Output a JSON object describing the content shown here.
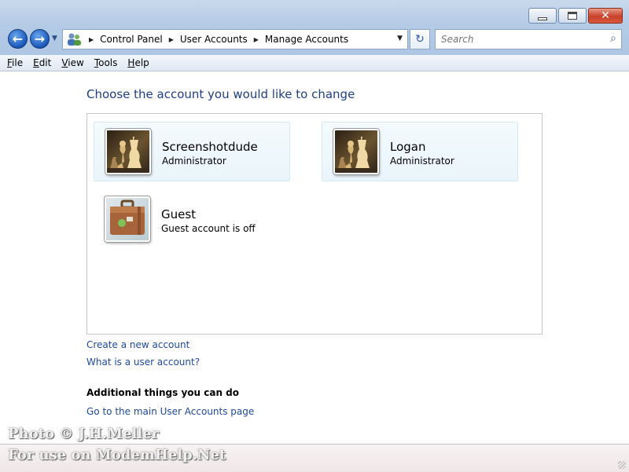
{
  "window": {
    "minimize_glyph": "",
    "maximize_glyph": "",
    "close_glyph": "✕"
  },
  "nav": {
    "back_glyph": "←",
    "forward_glyph": "→",
    "recent_glyph": "▼"
  },
  "address": {
    "separator_glyph": "▶",
    "crumbs": [
      "Control Panel",
      "User Accounts",
      "Manage Accounts"
    ],
    "dropdown_glyph": "▼",
    "refresh_glyph": "↻"
  },
  "search": {
    "placeholder": "Search",
    "icon_glyph": "⌕"
  },
  "menu": {
    "items": [
      "File",
      "Edit",
      "View",
      "Tools",
      "Help"
    ]
  },
  "main": {
    "heading": "Choose the account you would like to change",
    "accounts": [
      {
        "name": "Screenshotdude",
        "role": "Administrator",
        "picture": "chess-icon"
      },
      {
        "name": "Logan",
        "role": "Administrator",
        "picture": "chess-icon"
      },
      {
        "name": "Guest",
        "role": "Guest account is off",
        "picture": "suitcase-icon"
      }
    ],
    "links": {
      "create_account": "Create a new account",
      "what_is": "What is a user account?"
    },
    "additional_heading": "Additional things you can do",
    "main_page_link": "Go to the main User Accounts page"
  },
  "watermark": {
    "line1": "Photo © J.H.Meller",
    "line2": "For use on ModemHelp.Net"
  },
  "colors": {
    "heading": "#1e3e8a",
    "link": "#1e4aa0",
    "chrome": "#b4cbe6"
  }
}
